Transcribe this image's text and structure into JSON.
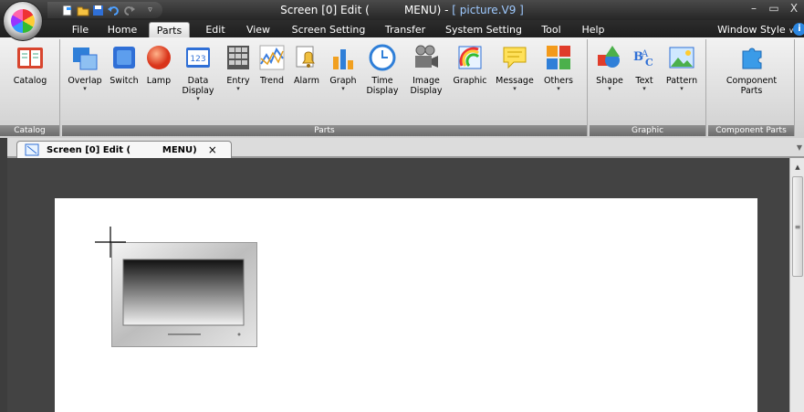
{
  "title": {
    "prefix": "Screen [0] Edit (",
    "mid": "MENU) - ",
    "file": "[ picture.V9 ]"
  },
  "window_controls": {
    "minimize": "–",
    "restore": "▭",
    "close": "X"
  },
  "tabs": [
    "File",
    "Home",
    "Parts",
    "Edit",
    "View",
    "Screen Setting",
    "Transfer",
    "System Setting",
    "Tool",
    "Help"
  ],
  "window_style": "Window Style",
  "ribbon": {
    "catalog": {
      "label": "Catalog",
      "group": "Catalog"
    },
    "parts_buttons": [
      {
        "label": "Overlap",
        "arrow": true
      },
      {
        "label": "Switch",
        "arrow": false
      },
      {
        "label": "Lamp",
        "arrow": false
      },
      {
        "label": "Data\nDisplay",
        "arrow": true
      },
      {
        "label": "Entry",
        "arrow": true
      },
      {
        "label": "Trend",
        "arrow": false
      },
      {
        "label": "Alarm",
        "arrow": false
      },
      {
        "label": "Graph",
        "arrow": true
      },
      {
        "label": "Time\nDisplay",
        "arrow": true
      },
      {
        "label": "Image\nDisplay",
        "arrow": true
      },
      {
        "label": "Graphic",
        "arrow": false
      },
      {
        "label": "Message",
        "arrow": true
      },
      {
        "label": "Others",
        "arrow": true
      }
    ],
    "parts_group": "Parts",
    "graphic_buttons": [
      {
        "label": "Shape",
        "arrow": true
      },
      {
        "label": "Text",
        "arrow": true
      },
      {
        "label": "Pattern",
        "arrow": true
      }
    ],
    "graphic_group": "Graphic",
    "component": {
      "label": "Component\nParts",
      "group": "Component Parts"
    }
  },
  "doc_tab": {
    "title": "Screen [0] Edit (          MENU)",
    "close": "×"
  },
  "data_display_icon_text": "123"
}
